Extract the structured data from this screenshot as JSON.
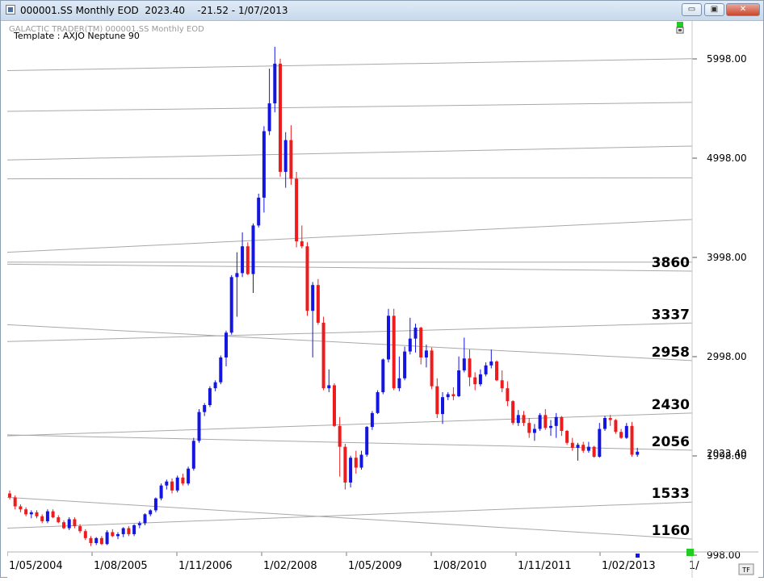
{
  "window": {
    "title": "000001.SS Monthly EOD  2023.40    -21.52 - 1/07/2013",
    "minimize_glyph": "▭",
    "maximize_glyph": "▣",
    "close_glyph": "✕"
  },
  "chart_header": {
    "source": "GALACTIC TRADER(TM)    000001.SS Monthly EOD",
    "template": "Template : AXJO Neptune 90"
  },
  "tf_label": "TF",
  "chart_data": {
    "type": "candlestick",
    "symbol": "000001.SS",
    "period": "Monthly",
    "last_value": 2023.4,
    "last_change": -21.52,
    "last_date": "1/07/2013",
    "ylim": [
      998.0,
      6100.0
    ],
    "y_ticks": [
      998.0,
      1998.0,
      2998.0,
      3998.0,
      4998.0,
      5998.0
    ],
    "y_tick_labels": [
      "998.00",
      "1998.00",
      "2998.00",
      "3998.00",
      "4998.00",
      "5998.00"
    ],
    "price_readout": "2023.40",
    "x_tick_labels": [
      "1/05/2004",
      "1/08/2005",
      "1/11/2006",
      "1/02/2008",
      "1/05/2009",
      "1/08/2010",
      "1/11/2011",
      "1/02/2013",
      "1/"
    ],
    "colors": {
      "up": "#1515e0",
      "down": "#ee1c1c",
      "line": "#a8a8a8",
      "background": "#ffffff",
      "indicator": "#22cc22"
    },
    "candles": [
      {
        "o": 1620,
        "h": 1650,
        "l": 1560,
        "c": 1580
      },
      {
        "o": 1580,
        "h": 1600,
        "l": 1460,
        "c": 1490
      },
      {
        "o": 1490,
        "h": 1510,
        "l": 1430,
        "c": 1460
      },
      {
        "o": 1460,
        "h": 1480,
        "l": 1390,
        "c": 1410
      },
      {
        "o": 1410,
        "h": 1450,
        "l": 1370,
        "c": 1430
      },
      {
        "o": 1430,
        "h": 1450,
        "l": 1370,
        "c": 1390
      },
      {
        "o": 1390,
        "h": 1410,
        "l": 1320,
        "c": 1340
      },
      {
        "o": 1340,
        "h": 1460,
        "l": 1320,
        "c": 1440
      },
      {
        "o": 1440,
        "h": 1460,
        "l": 1370,
        "c": 1380
      },
      {
        "o": 1380,
        "h": 1400,
        "l": 1320,
        "c": 1330
      },
      {
        "o": 1330,
        "h": 1350,
        "l": 1260,
        "c": 1270
      },
      {
        "o": 1270,
        "h": 1380,
        "l": 1250,
        "c": 1360
      },
      {
        "o": 1360,
        "h": 1380,
        "l": 1270,
        "c": 1290
      },
      {
        "o": 1290,
        "h": 1310,
        "l": 1220,
        "c": 1240
      },
      {
        "o": 1240,
        "h": 1260,
        "l": 1150,
        "c": 1170
      },
      {
        "o": 1170,
        "h": 1190,
        "l": 1090,
        "c": 1120
      },
      {
        "o": 1120,
        "h": 1180,
        "l": 1100,
        "c": 1170
      },
      {
        "o": 1170,
        "h": 1190,
        "l": 1100,
        "c": 1110
      },
      {
        "o": 1110,
        "h": 1250,
        "l": 1100,
        "c": 1230
      },
      {
        "o": 1230,
        "h": 1260,
        "l": 1180,
        "c": 1190
      },
      {
        "o": 1190,
        "h": 1230,
        "l": 1160,
        "c": 1210
      },
      {
        "o": 1210,
        "h": 1280,
        "l": 1180,
        "c": 1270
      },
      {
        "o": 1270,
        "h": 1290,
        "l": 1190,
        "c": 1210
      },
      {
        "o": 1210,
        "h": 1310,
        "l": 1190,
        "c": 1300
      },
      {
        "o": 1300,
        "h": 1340,
        "l": 1270,
        "c": 1320
      },
      {
        "o": 1320,
        "h": 1420,
        "l": 1300,
        "c": 1410
      },
      {
        "o": 1410,
        "h": 1460,
        "l": 1390,
        "c": 1450
      },
      {
        "o": 1450,
        "h": 1580,
        "l": 1430,
        "c": 1570
      },
      {
        "o": 1570,
        "h": 1720,
        "l": 1550,
        "c": 1700
      },
      {
        "o": 1700,
        "h": 1760,
        "l": 1660,
        "c": 1740
      },
      {
        "o": 1740,
        "h": 1770,
        "l": 1620,
        "c": 1650
      },
      {
        "o": 1650,
        "h": 1800,
        "l": 1630,
        "c": 1780
      },
      {
        "o": 1780,
        "h": 1820,
        "l": 1700,
        "c": 1720
      },
      {
        "o": 1720,
        "h": 1890,
        "l": 1700,
        "c": 1870
      },
      {
        "o": 1870,
        "h": 2180,
        "l": 1850,
        "c": 2150
      },
      {
        "o": 2150,
        "h": 2470,
        "l": 2130,
        "c": 2440
      },
      {
        "o": 2440,
        "h": 2530,
        "l": 2400,
        "c": 2510
      },
      {
        "o": 2510,
        "h": 2700,
        "l": 2490,
        "c": 2680
      },
      {
        "o": 2680,
        "h": 2760,
        "l": 2650,
        "c": 2740
      },
      {
        "o": 2740,
        "h": 3010,
        "l": 2720,
        "c": 2990
      },
      {
        "o": 2990,
        "h": 3260,
        "l": 2900,
        "c": 3240
      },
      {
        "o": 3240,
        "h": 3820,
        "l": 3220,
        "c": 3800
      },
      {
        "o": 3800,
        "h": 4050,
        "l": 3400,
        "c": 3840
      },
      {
        "o": 3840,
        "h": 4250,
        "l": 3800,
        "c": 4110
      },
      {
        "o": 4110,
        "h": 4150,
        "l": 3820,
        "c": 3830
      },
      {
        "o": 3830,
        "h": 4340,
        "l": 3640,
        "c": 4320
      },
      {
        "o": 4320,
        "h": 4640,
        "l": 4300,
        "c": 4600
      },
      {
        "o": 4600,
        "h": 5320,
        "l": 4450,
        "c": 5270
      },
      {
        "o": 5270,
        "h": 5900,
        "l": 5230,
        "c": 5550
      },
      {
        "o": 5550,
        "h": 6120,
        "l": 5460,
        "c": 5950
      },
      {
        "o": 5950,
        "h": 6000,
        "l": 4810,
        "c": 4860
      },
      {
        "o": 4860,
        "h": 5260,
        "l": 4700,
        "c": 5180
      },
      {
        "o": 5180,
        "h": 5330,
        "l": 4730,
        "c": 4790
      },
      {
        "o": 4790,
        "h": 4860,
        "l": 4100,
        "c": 4160
      },
      {
        "o": 4160,
        "h": 4320,
        "l": 4090,
        "c": 4110
      },
      {
        "o": 4110,
        "h": 4150,
        "l": 3410,
        "c": 3460
      },
      {
        "o": 3460,
        "h": 3750,
        "l": 2990,
        "c": 3720
      },
      {
        "o": 3720,
        "h": 3780,
        "l": 3320,
        "c": 3340
      },
      {
        "o": 3340,
        "h": 3400,
        "l": 2660,
        "c": 2680
      },
      {
        "o": 2680,
        "h": 2870,
        "l": 2640,
        "c": 2710
      },
      {
        "o": 2710,
        "h": 2730,
        "l": 2290,
        "c": 2300
      },
      {
        "o": 2300,
        "h": 2390,
        "l": 1790,
        "c": 2090
      },
      {
        "o": 2090,
        "h": 2120,
        "l": 1660,
        "c": 1730
      },
      {
        "o": 1730,
        "h": 2000,
        "l": 1680,
        "c": 1980
      },
      {
        "o": 1980,
        "h": 2050,
        "l": 1820,
        "c": 1880
      },
      {
        "o": 1880,
        "h": 2050,
        "l": 1860,
        "c": 2010
      },
      {
        "o": 2010,
        "h": 2300,
        "l": 1990,
        "c": 2290
      },
      {
        "o": 2290,
        "h": 2450,
        "l": 2260,
        "c": 2430
      },
      {
        "o": 2430,
        "h": 2660,
        "l": 2420,
        "c": 2640
      },
      {
        "o": 2640,
        "h": 2980,
        "l": 2620,
        "c": 2970
      },
      {
        "o": 2970,
        "h": 3480,
        "l": 2940,
        "c": 3410
      },
      {
        "o": 3410,
        "h": 3480,
        "l": 2660,
        "c": 2680
      },
      {
        "o": 2680,
        "h": 3000,
        "l": 2650,
        "c": 2780
      },
      {
        "o": 2780,
        "h": 3100,
        "l": 2760,
        "c": 3050
      },
      {
        "o": 3050,
        "h": 3390,
        "l": 3020,
        "c": 3180
      },
      {
        "o": 3180,
        "h": 3330,
        "l": 3040,
        "c": 3290
      },
      {
        "o": 3290,
        "h": 3300,
        "l": 2920,
        "c": 2990
      },
      {
        "o": 2990,
        "h": 3120,
        "l": 2890,
        "c": 3060
      },
      {
        "o": 3060,
        "h": 3090,
        "l": 2670,
        "c": 2700
      },
      {
        "o": 2700,
        "h": 2780,
        "l": 2380,
        "c": 2420
      },
      {
        "o": 2420,
        "h": 2640,
        "l": 2320,
        "c": 2590
      },
      {
        "o": 2590,
        "h": 2640,
        "l": 2560,
        "c": 2620
      },
      {
        "o": 2620,
        "h": 2690,
        "l": 2560,
        "c": 2600
      },
      {
        "o": 2600,
        "h": 3000,
        "l": 2590,
        "c": 2860
      },
      {
        "o": 2860,
        "h": 3190,
        "l": 2840,
        "c": 2980
      },
      {
        "o": 2980,
        "h": 3070,
        "l": 2700,
        "c": 2790
      },
      {
        "o": 2790,
        "h": 2840,
        "l": 2660,
        "c": 2720
      },
      {
        "o": 2720,
        "h": 2870,
        "l": 2700,
        "c": 2820
      },
      {
        "o": 2820,
        "h": 2940,
        "l": 2800,
        "c": 2910
      },
      {
        "o": 2910,
        "h": 3070,
        "l": 2880,
        "c": 2950
      },
      {
        "o": 2950,
        "h": 2960,
        "l": 2750,
        "c": 2760
      },
      {
        "o": 2760,
        "h": 2860,
        "l": 2640,
        "c": 2680
      },
      {
        "o": 2680,
        "h": 2750,
        "l": 2500,
        "c": 2550
      },
      {
        "o": 2550,
        "h": 2560,
        "l": 2310,
        "c": 2330
      },
      {
        "o": 2330,
        "h": 2460,
        "l": 2300,
        "c": 2410
      },
      {
        "o": 2410,
        "h": 2450,
        "l": 2300,
        "c": 2330
      },
      {
        "o": 2330,
        "h": 2380,
        "l": 2180,
        "c": 2230
      },
      {
        "o": 2230,
        "h": 2320,
        "l": 2150,
        "c": 2270
      },
      {
        "o": 2270,
        "h": 2430,
        "l": 2250,
        "c": 2410
      },
      {
        "o": 2410,
        "h": 2470,
        "l": 2260,
        "c": 2280
      },
      {
        "o": 2280,
        "h": 2360,
        "l": 2200,
        "c": 2300
      },
      {
        "o": 2300,
        "h": 2430,
        "l": 2180,
        "c": 2390
      },
      {
        "o": 2390,
        "h": 2400,
        "l": 2200,
        "c": 2250
      },
      {
        "o": 2250,
        "h": 2260,
        "l": 2110,
        "c": 2130
      },
      {
        "o": 2130,
        "h": 2180,
        "l": 2050,
        "c": 2080
      },
      {
        "o": 2080,
        "h": 2130,
        "l": 1950,
        "c": 2110
      },
      {
        "o": 2110,
        "h": 2140,
        "l": 2030,
        "c": 2050
      },
      {
        "o": 2050,
        "h": 2140,
        "l": 2030,
        "c": 2090
      },
      {
        "o": 2090,
        "h": 2100,
        "l": 1980,
        "c": 1990
      },
      {
        "o": 1990,
        "h": 2330,
        "l": 1980,
        "c": 2270
      },
      {
        "o": 2270,
        "h": 2400,
        "l": 2250,
        "c": 2380
      },
      {
        "o": 2380,
        "h": 2410,
        "l": 2300,
        "c": 2360
      },
      {
        "o": 2360,
        "h": 2370,
        "l": 2220,
        "c": 2240
      },
      {
        "o": 2240,
        "h": 2270,
        "l": 2170,
        "c": 2180
      },
      {
        "o": 2180,
        "h": 2330,
        "l": 2170,
        "c": 2300
      },
      {
        "o": 2300,
        "h": 2340,
        "l": 1990,
        "c": 2010
      },
      {
        "o": 2010,
        "h": 2080,
        "l": 1990,
        "c": 2040
      }
    ],
    "lines": [
      {
        "label": "",
        "y_start": 5880,
        "y_end": 6000
      },
      {
        "label": "",
        "y_start": 5470,
        "y_end": 5560
      },
      {
        "label": "",
        "y_start": 4980,
        "y_end": 5120
      },
      {
        "label": "",
        "y_start": 4790,
        "y_end": 4800
      },
      {
        "label": "",
        "y_start": 4050,
        "y_end": 4380
      },
      {
        "label": "",
        "y_start": 3950,
        "y_end": 3950
      },
      {
        "label": "3860",
        "y_start": 3930,
        "y_end": 3860
      },
      {
        "label": "3337",
        "y_start": 3150,
        "y_end": 3337
      },
      {
        "label": "2958",
        "y_start": 3320,
        "y_end": 2958
      },
      {
        "label": "2430",
        "y_start": 2200,
        "y_end": 2430
      },
      {
        "label": "2056",
        "y_start": 2210,
        "y_end": 2056
      },
      {
        "label": "1533",
        "y_start": 1270,
        "y_end": 1533
      },
      {
        "label": "1160",
        "y_start": 1580,
        "y_end": 1160
      }
    ]
  }
}
